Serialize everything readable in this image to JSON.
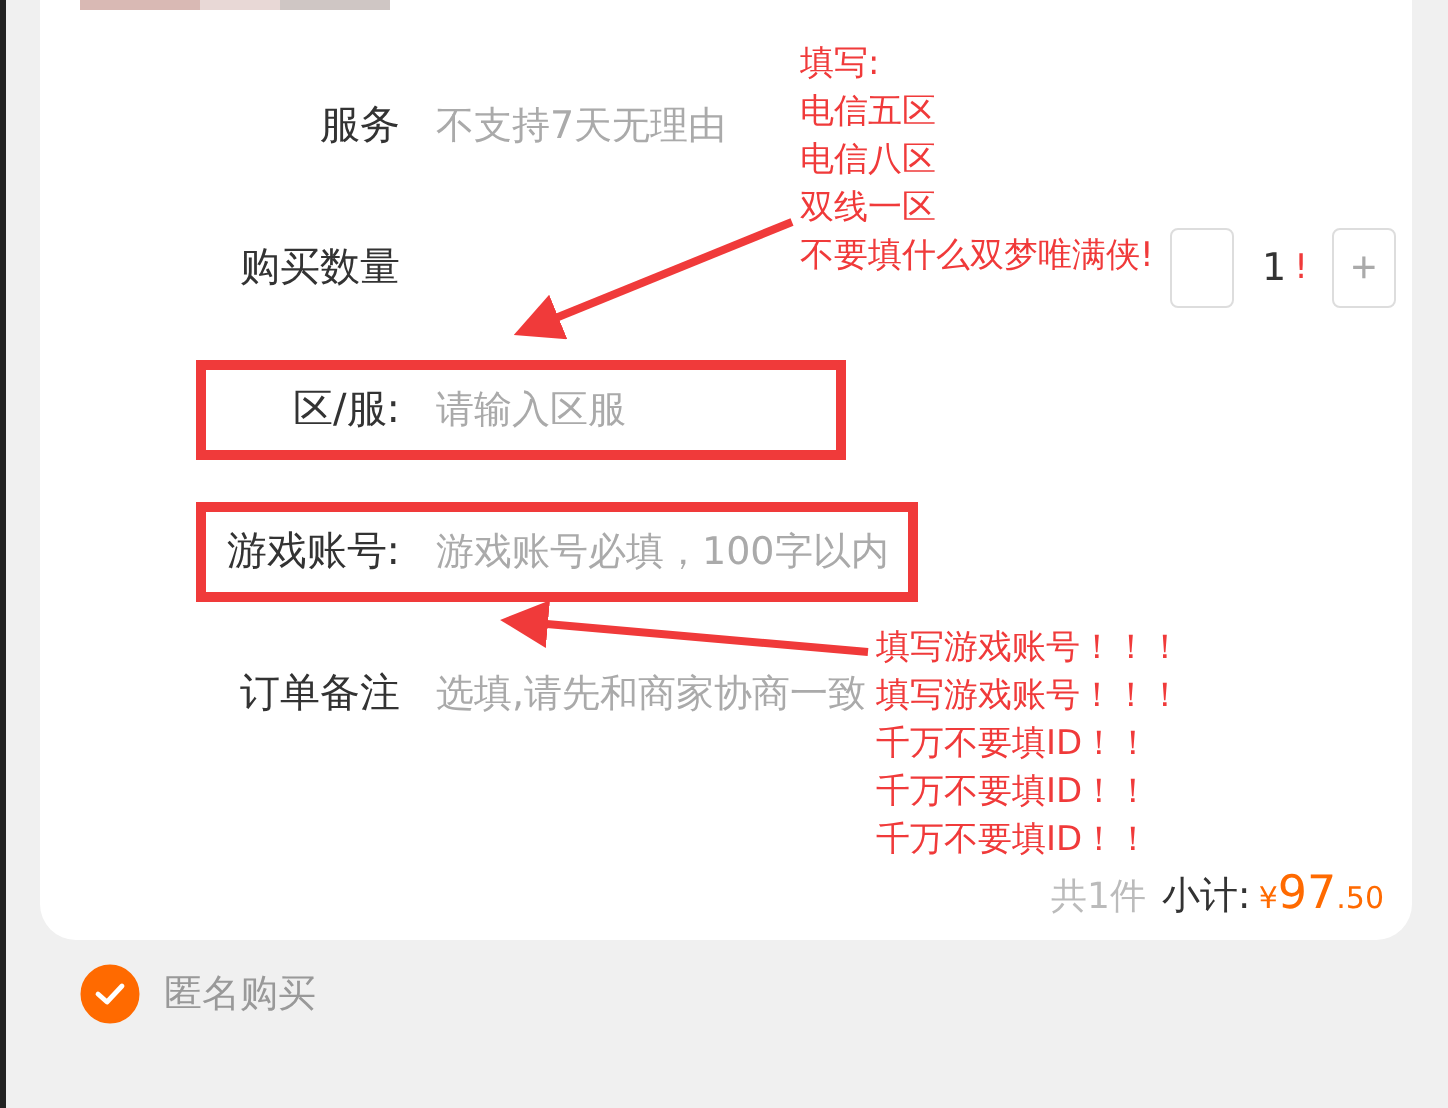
{
  "order": {
    "rows": [
      {
        "kind": "text",
        "label": "服务",
        "value": "不支持7天无理由",
        "highlighted": false
      },
      {
        "kind": "stepper",
        "label": "购买数量",
        "quantity": "1",
        "plus": "+",
        "highlighted": false
      },
      {
        "kind": "input",
        "label": "区/服:",
        "placeholder": "请输入区服",
        "highlighted": true
      },
      {
        "kind": "input",
        "label": "游戏账号:",
        "placeholder": "游戏账号必填，100字以内",
        "highlighted": true
      },
      {
        "kind": "input",
        "label": "订单备注",
        "placeholder": "选填,请先和商家协商一致",
        "highlighted": false
      }
    ],
    "subtotal": {
      "count": "共1件",
      "label": "小计:",
      "currency": "¥",
      "integer": "97",
      "decimal": ".50"
    }
  },
  "anonymous": {
    "label": "匿名购买",
    "checked": true
  },
  "annotations": [
    {
      "lines": [
        "填写:",
        "电信五区",
        "电信八区",
        "双线一区",
        "不要填什么双梦唯满侠!"
      ],
      "tail": "!"
    },
    {
      "lines": [
        "填写游戏账号！！！",
        "填写游戏账号！！！",
        "千万不要填ID！！",
        "千万不要填ID！！",
        "千万不要填ID！！"
      ]
    }
  ]
}
